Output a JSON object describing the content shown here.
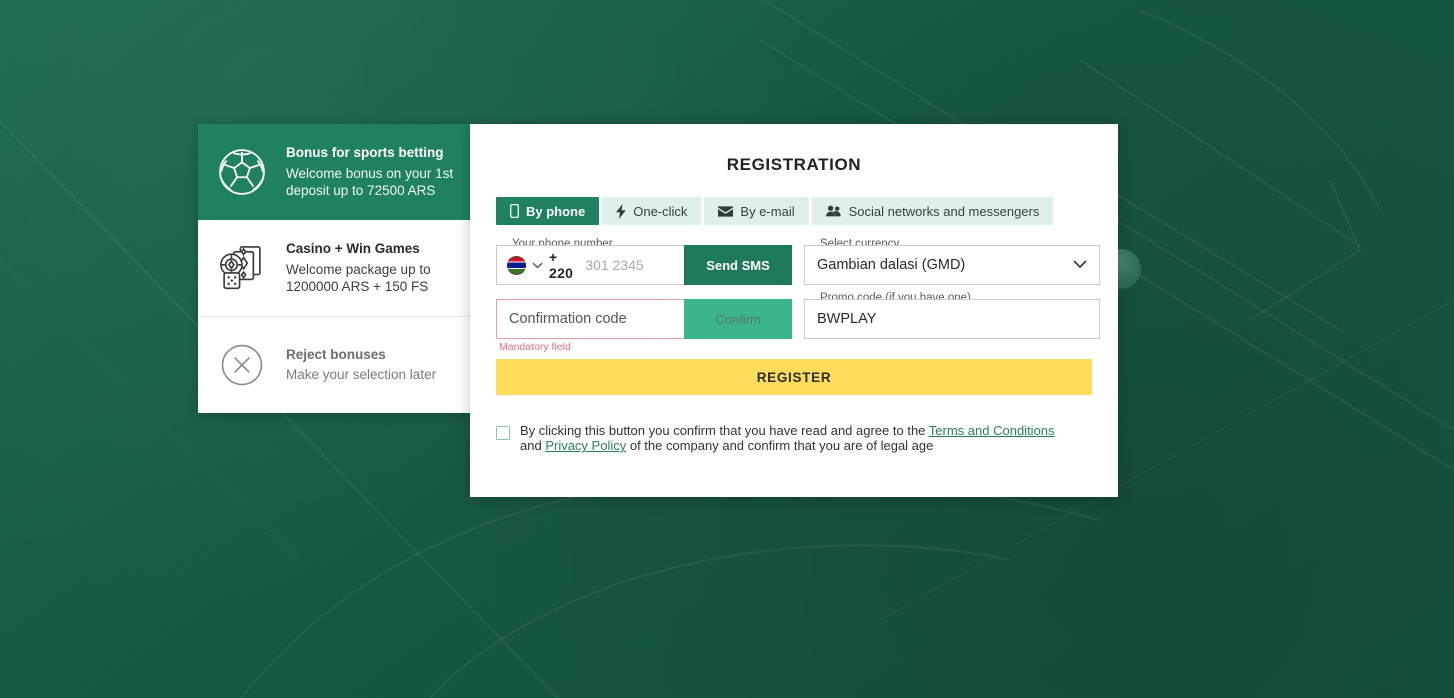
{
  "bonus_panel": {
    "cards": [
      {
        "icon": "football-icon",
        "title": "Bonus for sports betting",
        "subtitle": "Welcome bonus on your 1st deposit up to 72500 ARS",
        "selected": true
      },
      {
        "icon": "casino-chips-cards-icon",
        "title": "Casino + Win Games",
        "subtitle": "Welcome package up to 1200000 ARS + 150 FS",
        "selected": false
      },
      {
        "icon": "circle-x-icon",
        "title": "Reject bonuses",
        "subtitle": "Make your selection later",
        "selected": false
      }
    ]
  },
  "registration": {
    "title": "REGISTRATION",
    "tabs": [
      {
        "label": "By phone",
        "icon": "mobile-phone-icon",
        "active": true
      },
      {
        "label": "One-click",
        "icon": "lightning-bolt-icon",
        "active": false
      },
      {
        "label": "By e-mail",
        "icon": "envelope-icon",
        "active": false
      },
      {
        "label": "Social networks and messengers",
        "icon": "users-group-icon",
        "active": false
      }
    ],
    "phone_field": {
      "label": "Your phone number",
      "country_flag": "gambia-flag-icon",
      "dial_code": "+ 220",
      "placeholder": "301 2345",
      "value": "",
      "button_label": "Send SMS"
    },
    "currency_field": {
      "label": "Select currency",
      "value": "Gambian dalasi (GMD)",
      "chevron": "chevron-down-icon"
    },
    "confirmation_field": {
      "label": "",
      "placeholder": "Confirmation code",
      "value": "",
      "button_label": "Confirm",
      "error": "Mandatory field"
    },
    "promo_field": {
      "label": "Promo code (if you have one)",
      "value": "BWPLAY",
      "placeholder": ""
    },
    "register_button": "REGISTER",
    "terms": {
      "checked": false,
      "part1": "By clicking this button you confirm that you have read and agree to the ",
      "link1": "Terms and Conditions",
      "part2": " and ",
      "link2": "Privacy Policy",
      "part3": " of the company and confirm that you are of legal age"
    }
  },
  "colors": {
    "brand_green": "#1f8160",
    "send_green": "#1f7a5c",
    "confirm_green": "#3bb68c",
    "tab_inactive": "#dff0e8",
    "register_yellow": "#ffdb5c",
    "error_red": "#e2717c",
    "background_green": "#17573f"
  }
}
